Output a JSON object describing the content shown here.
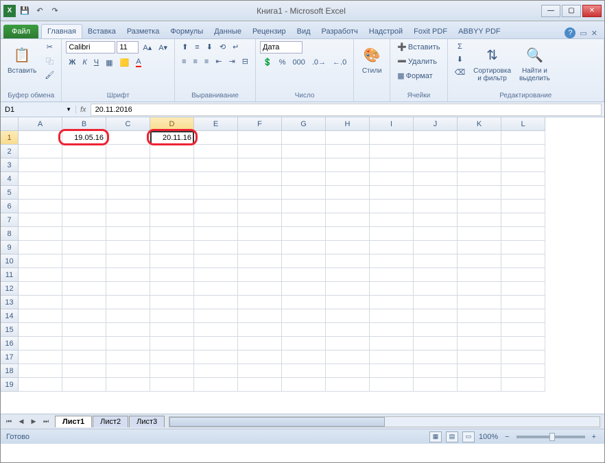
{
  "titlebar": {
    "title": "Книга1  -  Microsoft Excel"
  },
  "tabs": {
    "file": "Файл",
    "items": [
      "Главная",
      "Вставка",
      "Разметка",
      "Формулы",
      "Данные",
      "Рецензир",
      "Вид",
      "Разработч",
      "Надстрой",
      "Foxit PDF",
      "ABBYY PDF"
    ],
    "active": 0
  },
  "ribbon": {
    "clipboard": {
      "paste": "Вставить",
      "label": "Буфер обмена"
    },
    "font": {
      "name": "Calibri",
      "size": "11",
      "bold": "Ж",
      "italic": "К",
      "underline": "Ч",
      "label": "Шрифт"
    },
    "align": {
      "label": "Выравнивание"
    },
    "number": {
      "format": "Дата",
      "label": "Число"
    },
    "styles": {
      "label": "Стили",
      "styles_btn": "Стили"
    },
    "cells": {
      "insert": "Вставить",
      "delete": "Удалить",
      "format": "Формат",
      "label": "Ячейки"
    },
    "editing": {
      "sort": "Сортировка\nи фильтр",
      "find": "Найти и\nвыделить",
      "label": "Редактирование"
    }
  },
  "namebox": {
    "ref": "D1",
    "formula": "20.11.2016"
  },
  "columns": [
    "A",
    "B",
    "C",
    "D",
    "E",
    "F",
    "G",
    "H",
    "I",
    "J",
    "K",
    "L"
  ],
  "rows": 19,
  "cells": {
    "B1": "19.05.16",
    "D1": "20.11.16"
  },
  "active_cell": "D1",
  "sheets": {
    "tabs": [
      "Лист1",
      "Лист2",
      "Лист3"
    ],
    "active": 0
  },
  "status": {
    "ready": "Готово",
    "zoom": "100%"
  }
}
